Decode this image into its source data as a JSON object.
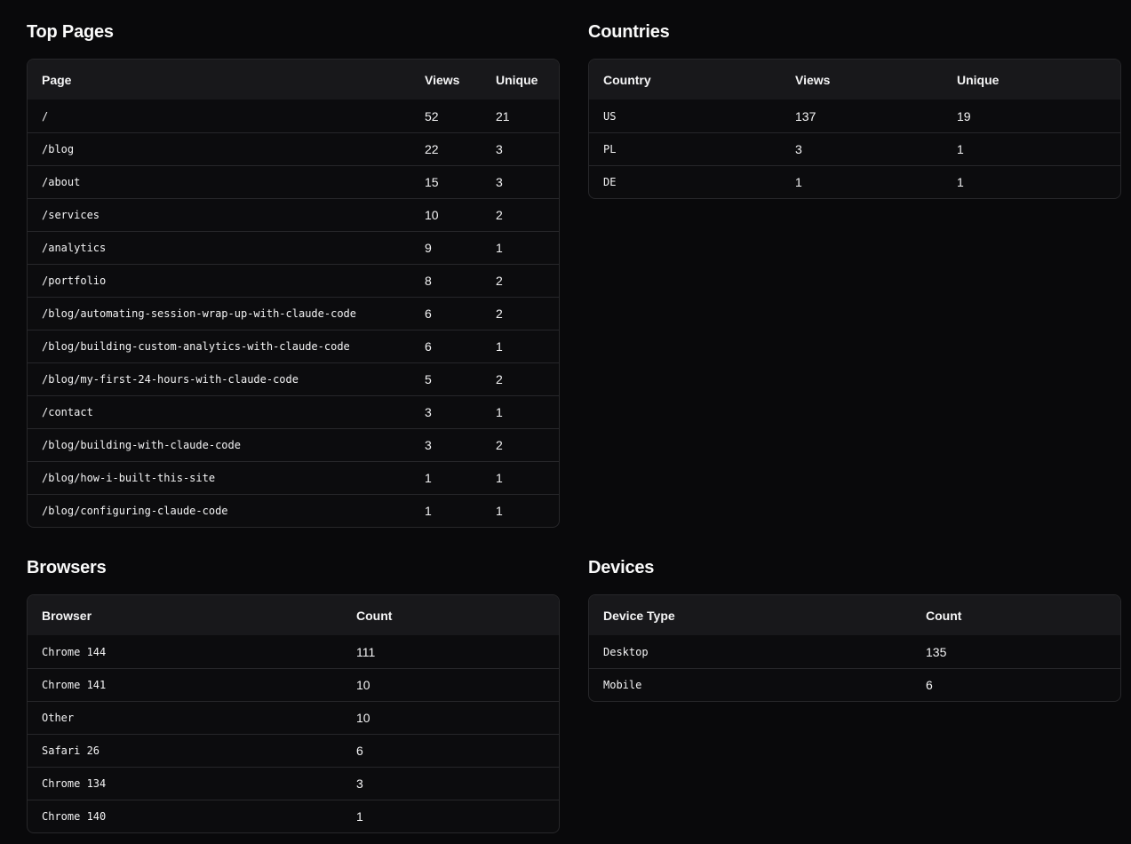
{
  "top_pages": {
    "title": "Top Pages",
    "headers": [
      "Page",
      "Views",
      "Unique"
    ],
    "rows": [
      {
        "page": "/",
        "views": "52",
        "unique": "21"
      },
      {
        "page": "/blog",
        "views": "22",
        "unique": "3"
      },
      {
        "page": "/about",
        "views": "15",
        "unique": "3"
      },
      {
        "page": "/services",
        "views": "10",
        "unique": "2"
      },
      {
        "page": "/analytics",
        "views": "9",
        "unique": "1"
      },
      {
        "page": "/portfolio",
        "views": "8",
        "unique": "2"
      },
      {
        "page": "/blog/automating-session-wrap-up-with-claude-code",
        "views": "6",
        "unique": "2"
      },
      {
        "page": "/blog/building-custom-analytics-with-claude-code",
        "views": "6",
        "unique": "1"
      },
      {
        "page": "/blog/my-first-24-hours-with-claude-code",
        "views": "5",
        "unique": "2"
      },
      {
        "page": "/contact",
        "views": "3",
        "unique": "1"
      },
      {
        "page": "/blog/building-with-claude-code",
        "views": "3",
        "unique": "2"
      },
      {
        "page": "/blog/how-i-built-this-site",
        "views": "1",
        "unique": "1"
      },
      {
        "page": "/blog/configuring-claude-code",
        "views": "1",
        "unique": "1"
      }
    ]
  },
  "countries": {
    "title": "Countries",
    "headers": [
      "Country",
      "Views",
      "Unique"
    ],
    "rows": [
      {
        "country": "US",
        "views": "137",
        "unique": "19"
      },
      {
        "country": "PL",
        "views": "3",
        "unique": "1"
      },
      {
        "country": "DE",
        "views": "1",
        "unique": "1"
      }
    ]
  },
  "browsers": {
    "title": "Browsers",
    "headers": [
      "Browser",
      "Count"
    ],
    "rows": [
      {
        "browser": "Chrome 144",
        "count": "111"
      },
      {
        "browser": "Chrome 141",
        "count": "10"
      },
      {
        "browser": "Other",
        "count": "10"
      },
      {
        "browser": "Safari 26",
        "count": "6"
      },
      {
        "browser": "Chrome 134",
        "count": "3"
      },
      {
        "browser": "Chrome 140",
        "count": "1"
      }
    ]
  },
  "devices": {
    "title": "Devices",
    "headers": [
      "Device Type",
      "Count"
    ],
    "rows": [
      {
        "device": "Desktop",
        "count": "135"
      },
      {
        "device": "Mobile",
        "count": "6"
      }
    ]
  },
  "colors": {
    "background": "#09090b",
    "card_border": "#27272a",
    "header_row": "#18181b",
    "text": "#fafafa"
  }
}
